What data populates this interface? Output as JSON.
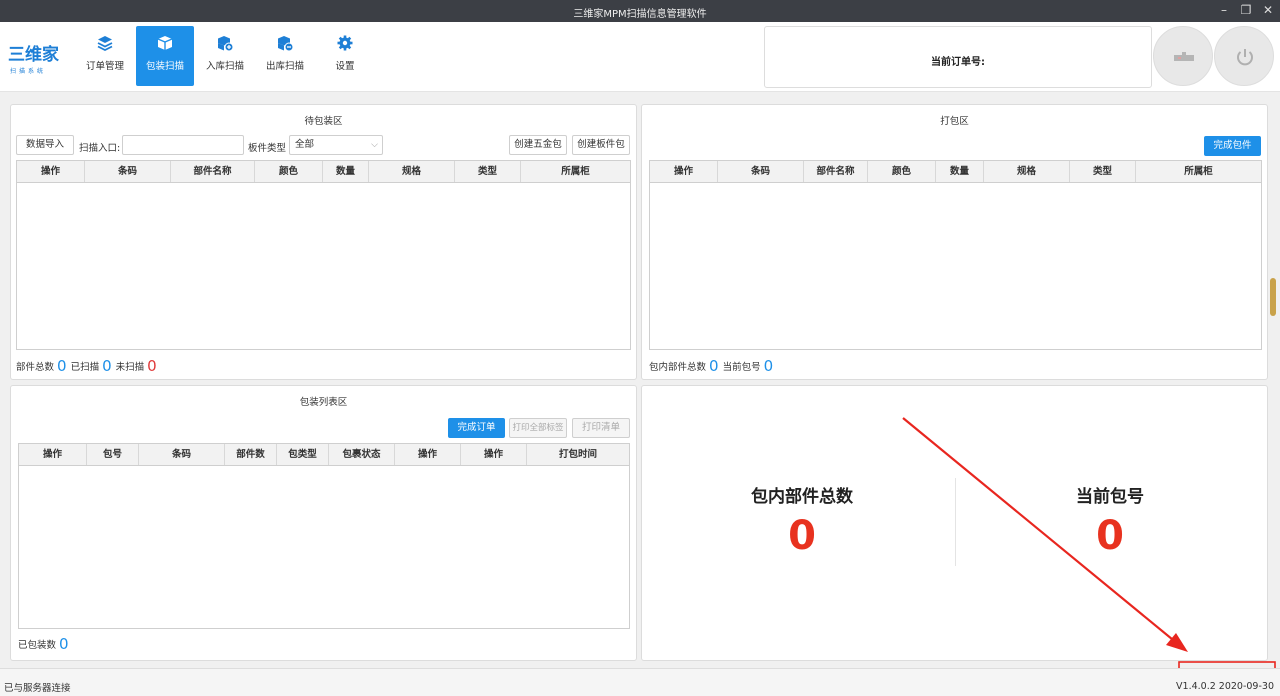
{
  "window": {
    "title": "三维家MPM扫描信息管理软件"
  },
  "logo": {
    "main": "三维家",
    "sub": "扫描系统"
  },
  "nav": [
    {
      "label": "订单管理",
      "icon": "layers-icon"
    },
    {
      "label": "包装扫描",
      "icon": "package-icon",
      "active": true
    },
    {
      "label": "入库扫描",
      "icon": "box-in-icon"
    },
    {
      "label": "出库扫描",
      "icon": "box-out-icon"
    },
    {
      "label": "设置",
      "icon": "gear-icon"
    }
  ],
  "order": {
    "label": "当前订单号:"
  },
  "pending": {
    "title": "待包装区",
    "import_btn": "数据导入",
    "scan_label": "扫描入口:",
    "board_type_label": "板件类型",
    "board_type_value": "全部",
    "create_hardware_btn": "创建五金包",
    "create_board_btn": "创建板件包",
    "columns": [
      "操作",
      "条码",
      "部件名称",
      "颜色",
      "数量",
      "规格",
      "类型",
      "所属柜"
    ],
    "stats": {
      "total_label": "部件总数",
      "total": "0",
      "scanned_label": "已扫描",
      "scanned": "0",
      "unscanned_label": "未扫描",
      "unscanned": "0"
    }
  },
  "packing": {
    "title": "打包区",
    "complete_btn": "完成包件",
    "columns": [
      "操作",
      "条码",
      "部件名称",
      "颜色",
      "数量",
      "规格",
      "类型",
      "所属柜"
    ],
    "stats": {
      "in_pack_label": "包内部件总数",
      "in_pack": "0",
      "current_label": "当前包号",
      "current": "0"
    }
  },
  "package_list": {
    "title": "包装列表区",
    "complete_order_btn": "完成订单",
    "print_all_btn": "打印全部标签",
    "print_list_btn": "打印清单",
    "columns": [
      "操作",
      "包号",
      "条码",
      "部件数",
      "包类型",
      "包裹状态",
      "操作",
      "操作",
      "打包时间"
    ],
    "stats": {
      "packed_label": "已包装数",
      "packed": "0"
    }
  },
  "summary": {
    "in_pack_label": "包内部件总数",
    "in_pack": "0",
    "current_label": "当前包号",
    "current": "0"
  },
  "status": {
    "connection": "已与服务器连接",
    "version": "V1.4.0.2 2020-09-30"
  },
  "colors": {
    "accent": "#1e90e8",
    "danger": "#e8321f"
  }
}
